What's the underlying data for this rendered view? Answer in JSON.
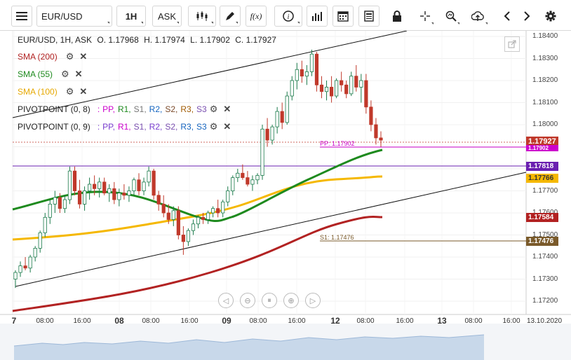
{
  "toolbar": {
    "symbol": "EUR/USD",
    "timeframe": "1H",
    "price_type": "ASK",
    "function_label": "f(x)"
  },
  "ohlc": {
    "text": "EUR/USD, 1H, ASK",
    "o": "O. 1.17968",
    "h": "H. 1.17974",
    "l": "L. 1.17902",
    "c": "C. 1.17927"
  },
  "indicators": [
    {
      "label": "SMA (200)",
      "color": "#b22222"
    },
    {
      "label": "SMA (55)",
      "color": "#1e8a1e"
    },
    {
      "label": "SMA (100)",
      "color": "#f5b800"
    }
  ],
  "pivots": [
    {
      "label": "PIVOTPOINT (0, 8)",
      "parts": [
        ":",
        "PP,",
        "R1,",
        "S1,",
        "R2,",
        "S2,",
        "R3,",
        "S3"
      ],
      "colors": [
        "#c0c",
        "#c0c",
        "#1e8a1e",
        "#777",
        "#1565c0",
        "#7b4a2a",
        "#a05a00",
        "#7a4fb0"
      ]
    },
    {
      "label": "PIVOTPOINT (0, 9)",
      "parts": [
        ":",
        "PP,",
        "R1,",
        "S1,",
        "R2,",
        "S2,",
        "R3,",
        "S3"
      ],
      "colors": [
        "#7a3fd0",
        "#7a3fd0",
        "#c0c",
        "#7a4fb0",
        "#7a3fd0",
        "#7a4fb0",
        "#1565c0",
        "#1565c0"
      ]
    }
  ],
  "pivot_lines": {
    "pp_label": "PP: 1.17902",
    "s1_label": "S1: 1.17476"
  },
  "price_tags": [
    {
      "value": "1.17927",
      "color": "#c0392b"
    },
    {
      "value": "1.17902",
      "color": "#c0c"
    },
    {
      "value": "1.17818",
      "color": "#6a1fb0"
    },
    {
      "value": "1.17766",
      "color": "#f5b800"
    },
    {
      "value": "1.17584",
      "color": "#b22222"
    },
    {
      "value": "1.17476",
      "color": "#7a5a2a"
    }
  ],
  "chart_data": {
    "type": "candlestick",
    "symbol": "EUR/USD",
    "interval": "1H",
    "y_ticks": [
      "1.18400",
      "1.18300",
      "1.18200",
      "1.18100",
      "1.18000",
      "1.17900",
      "1.17800",
      "1.17700",
      "1.17600",
      "1.17500",
      "1.17400",
      "1.17300",
      "1.17200"
    ],
    "ylim": [
      1.1715,
      1.1845
    ],
    "x_ticks": [
      {
        "label": "7",
        "bold": true
      },
      {
        "label": "08:00",
        "bold": false
      },
      {
        "label": "16:00",
        "bold": false
      },
      {
        "label": "08",
        "bold": true
      },
      {
        "label": "08:00",
        "bold": false
      },
      {
        "label": "16:00",
        "bold": false
      },
      {
        "label": "09",
        "bold": true
      },
      {
        "label": "08:00",
        "bold": false
      },
      {
        "label": "16:00",
        "bold": false
      },
      {
        "label": "12",
        "bold": true
      },
      {
        "label": "08:00",
        "bold": false
      },
      {
        "label": "16:00",
        "bold": false
      },
      {
        "label": "13",
        "bold": true
      },
      {
        "label": "08:00",
        "bold": false
      },
      {
        "label": "16:00",
        "bold": false
      },
      {
        "label": "13.10.2020",
        "bold": false
      }
    ],
    "candles": [
      [
        1.173,
        1.1734,
        1.1726,
        1.1733
      ],
      [
        1.1733,
        1.1738,
        1.1731,
        1.1736
      ],
      [
        1.1736,
        1.174,
        1.1734,
        1.1735
      ],
      [
        1.1735,
        1.1741,
        1.1733,
        1.174
      ],
      [
        1.174,
        1.1745,
        1.1738,
        1.1744
      ],
      [
        1.1744,
        1.1752,
        1.1742,
        1.1751
      ],
      [
        1.1751,
        1.176,
        1.1749,
        1.1758
      ],
      [
        1.1758,
        1.1766,
        1.1755,
        1.1764
      ],
      [
        1.1764,
        1.177,
        1.176,
        1.1767
      ],
      [
        1.1767,
        1.1769,
        1.176,
        1.1762
      ],
      [
        1.1762,
        1.1768,
        1.176,
        1.1766
      ],
      [
        1.1766,
        1.1781,
        1.1764,
        1.1779
      ],
      [
        1.1779,
        1.1781,
        1.1768,
        1.177
      ],
      [
        1.177,
        1.1775,
        1.1762,
        1.1764
      ],
      [
        1.1764,
        1.1772,
        1.1761,
        1.177
      ],
      [
        1.177,
        1.1776,
        1.1766,
        1.1773
      ],
      [
        1.1773,
        1.1777,
        1.1768,
        1.1771
      ],
      [
        1.1771,
        1.1776,
        1.1767,
        1.1774
      ],
      [
        1.1774,
        1.1776,
        1.1768,
        1.1769
      ],
      [
        1.1769,
        1.1773,
        1.1765,
        1.1771
      ],
      [
        1.1771,
        1.1774,
        1.1764,
        1.1766
      ],
      [
        1.1766,
        1.1771,
        1.1763,
        1.1769
      ],
      [
        1.1769,
        1.1773,
        1.1766,
        1.1768
      ],
      [
        1.1768,
        1.1772,
        1.1765,
        1.177
      ],
      [
        1.177,
        1.1776,
        1.1768,
        1.1775
      ],
      [
        1.1775,
        1.1778,
        1.1768,
        1.177
      ],
      [
        1.177,
        1.1776,
        1.1768,
        1.1774
      ],
      [
        1.1774,
        1.1781,
        1.1772,
        1.1779
      ],
      [
        1.1779,
        1.178,
        1.1766,
        1.1768
      ],
      [
        1.1768,
        1.177,
        1.1761,
        1.1764
      ],
      [
        1.1764,
        1.1768,
        1.1758,
        1.176
      ],
      [
        1.176,
        1.1764,
        1.1755,
        1.1757
      ],
      [
        1.1757,
        1.1763,
        1.1754,
        1.1761
      ],
      [
        1.1761,
        1.1763,
        1.1748,
        1.175
      ],
      [
        1.175,
        1.1754,
        1.1741,
        1.1747
      ],
      [
        1.1747,
        1.1753,
        1.1745,
        1.1752
      ],
      [
        1.1752,
        1.1757,
        1.175,
        1.1755
      ],
      [
        1.1755,
        1.1759,
        1.1753,
        1.1758
      ],
      [
        1.1758,
        1.176,
        1.1755,
        1.1757
      ],
      [
        1.1757,
        1.1761,
        1.1755,
        1.176
      ],
      [
        1.176,
        1.1763,
        1.1758,
        1.1762
      ],
      [
        1.1762,
        1.1766,
        1.1758,
        1.176
      ],
      [
        1.176,
        1.1766,
        1.1758,
        1.1765
      ],
      [
        1.1765,
        1.1772,
        1.1763,
        1.177
      ],
      [
        1.177,
        1.1777,
        1.1768,
        1.1776
      ],
      [
        1.1776,
        1.178,
        1.1774,
        1.1778
      ],
      [
        1.1778,
        1.1782,
        1.1775,
        1.1776
      ],
      [
        1.1776,
        1.1779,
        1.1772,
        1.1773
      ],
      [
        1.1773,
        1.1777,
        1.177,
        1.1775
      ],
      [
        1.1775,
        1.1778,
        1.1773,
        1.1777
      ],
      [
        1.1777,
        1.18,
        1.1775,
        1.1798
      ],
      [
        1.1798,
        1.1803,
        1.179,
        1.1793
      ],
      [
        1.1793,
        1.18,
        1.1791,
        1.1799
      ],
      [
        1.1799,
        1.1808,
        1.1796,
        1.1806
      ],
      [
        1.1806,
        1.181,
        1.1798,
        1.1801
      ],
      [
        1.1801,
        1.1815,
        1.18,
        1.1813
      ],
      [
        1.1813,
        1.1822,
        1.1811,
        1.182
      ],
      [
        1.182,
        1.1828,
        1.1816,
        1.1825
      ],
      [
        1.1825,
        1.1829,
        1.1819,
        1.1822
      ],
      [
        1.1822,
        1.1827,
        1.1818,
        1.1824
      ],
      [
        1.1824,
        1.1834,
        1.1822,
        1.1832
      ],
      [
        1.1832,
        1.1833,
        1.1815,
        1.1818
      ],
      [
        1.1818,
        1.1822,
        1.1812,
        1.1815
      ],
      [
        1.1815,
        1.182,
        1.1811,
        1.1817
      ],
      [
        1.1817,
        1.1822,
        1.181,
        1.1813
      ],
      [
        1.1813,
        1.1821,
        1.1812,
        1.182
      ],
      [
        1.182,
        1.1824,
        1.1815,
        1.1818
      ],
      [
        1.1818,
        1.182,
        1.1812,
        1.1814
      ],
      [
        1.1814,
        1.1824,
        1.1813,
        1.1822
      ],
      [
        1.1822,
        1.1827,
        1.1815,
        1.1817
      ],
      [
        1.1817,
        1.1823,
        1.181,
        1.182
      ],
      [
        1.182,
        1.1823,
        1.1805,
        1.1808
      ],
      [
        1.1808,
        1.1811,
        1.1797,
        1.18
      ],
      [
        1.18,
        1.1803,
        1.1791,
        1.1794
      ],
      [
        1.1794,
        1.1797,
        1.179,
        1.1793
      ]
    ]
  }
}
